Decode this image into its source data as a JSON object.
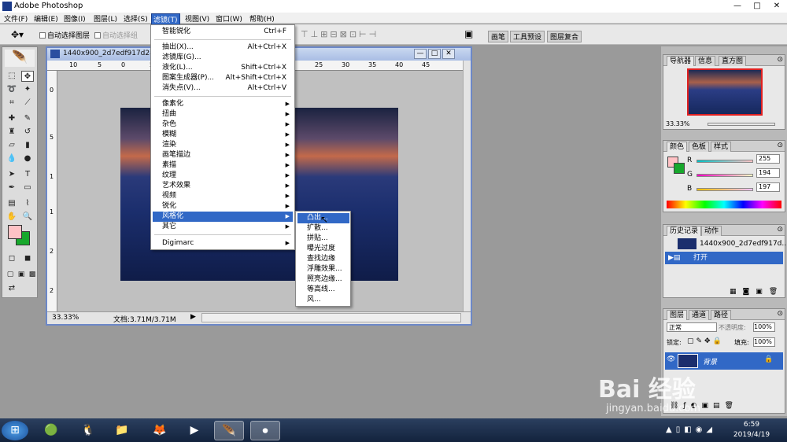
{
  "window": {
    "title": "Adobe Photoshop",
    "min": "—",
    "max": "□",
    "close": "✕"
  },
  "menubar": [
    "文件(F)",
    "编辑(E)",
    "图像(I)",
    "图层(L)",
    "选择(S)",
    "滤镜(T)",
    "视图(V)",
    "窗口(W)",
    "帮助(H)"
  ],
  "optionsbar": {
    "auto_select_layer": "自动选择图层",
    "auto_select_group": "自动选择组",
    "tabs": [
      "画笔",
      "工具预设",
      "图层复合"
    ]
  },
  "document": {
    "title": "1440x900_2d7edf917d288",
    "zoom": "33.33%",
    "status": "文档:3.71M/3.71M",
    "ruler_top": [
      "10",
      "5",
      "0",
      "5",
      "10",
      "15",
      "20",
      "25",
      "30",
      "35",
      "40",
      "45"
    ],
    "ruler_left": [
      "0",
      "5",
      "1",
      "1",
      "2",
      "2"
    ]
  },
  "filter_menu": {
    "top": [
      {
        "label": "智能锐化",
        "shortcut": "Ctrl+F"
      }
    ],
    "group1": [
      {
        "label": "抽出(X)...",
        "shortcut": "Alt+Ctrl+X"
      },
      {
        "label": "滤镜库(G)...",
        "shortcut": ""
      },
      {
        "label": "液化(L)...",
        "shortcut": "Shift+Ctrl+X"
      },
      {
        "label": "图案生成器(P)...",
        "shortcut": "Alt+Shift+Ctrl+X"
      },
      {
        "label": "消失点(V)...",
        "shortcut": "Alt+Ctrl+V"
      }
    ],
    "group2": [
      "像素化",
      "扭曲",
      "杂色",
      "模糊",
      "渲染",
      "画笔描边",
      "素描",
      "纹理",
      "艺术效果",
      "视频",
      "锐化",
      "风格化",
      "其它"
    ],
    "group3": [
      "Digimarc"
    ]
  },
  "stylize_submenu": [
    "凸出...",
    "扩散...",
    "拼贴...",
    "曝光过度",
    "查找边缘",
    "浮雕效果...",
    "照亮边缘...",
    "等高线...",
    "风..."
  ],
  "navigator": {
    "tabs": [
      "导航器",
      "信息",
      "直方图"
    ],
    "zoom": "33.33%"
  },
  "color": {
    "tabs": [
      "颜色",
      "色板",
      "样式"
    ],
    "R": "255",
    "G": "194",
    "B": "197",
    "fg": "#ffc2c5",
    "bg": "#17a82c"
  },
  "history": {
    "tabs": [
      "历史记录",
      "动作"
    ],
    "snapshot": "1440x900_2d7edf917d...",
    "step": "打开"
  },
  "layers": {
    "tabs": [
      "图层",
      "通道",
      "路径"
    ],
    "blend": "正常",
    "opacity_label": "不透明度:",
    "opacity": "100%",
    "lock_label": "锁定:",
    "fill_label": "填充:",
    "fill": "100%",
    "layer_name": "背景"
  },
  "taskbar": {
    "time": "6:59",
    "date": "2019/4/19"
  },
  "watermark": {
    "line1": "Bai 经验",
    "line2": "jingyan.baidu.com"
  }
}
